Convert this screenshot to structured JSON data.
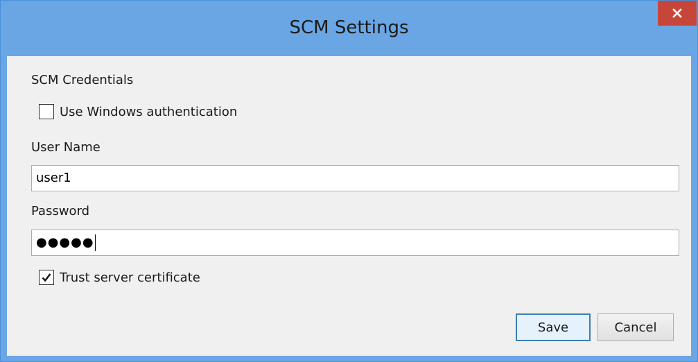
{
  "window": {
    "title": "SCM Settings",
    "close_icon": "close-icon"
  },
  "form": {
    "section_label": "SCM Credentials",
    "use_windows_auth": {
      "label": "Use Windows authentication",
      "checked": false
    },
    "username": {
      "label": "User Name",
      "value": "user1"
    },
    "password": {
      "label": "Password",
      "masked_value": "●●●●●"
    },
    "trust_cert": {
      "label": "Trust server certificate",
      "checked": true
    }
  },
  "buttons": {
    "save_label": "Save",
    "cancel_label": "Cancel"
  },
  "colors": {
    "titlebar": "#6aa6e4",
    "close_button": "#c7463a",
    "client_bg": "#f0f0f0",
    "primary_button_border": "#3c7fb1"
  }
}
